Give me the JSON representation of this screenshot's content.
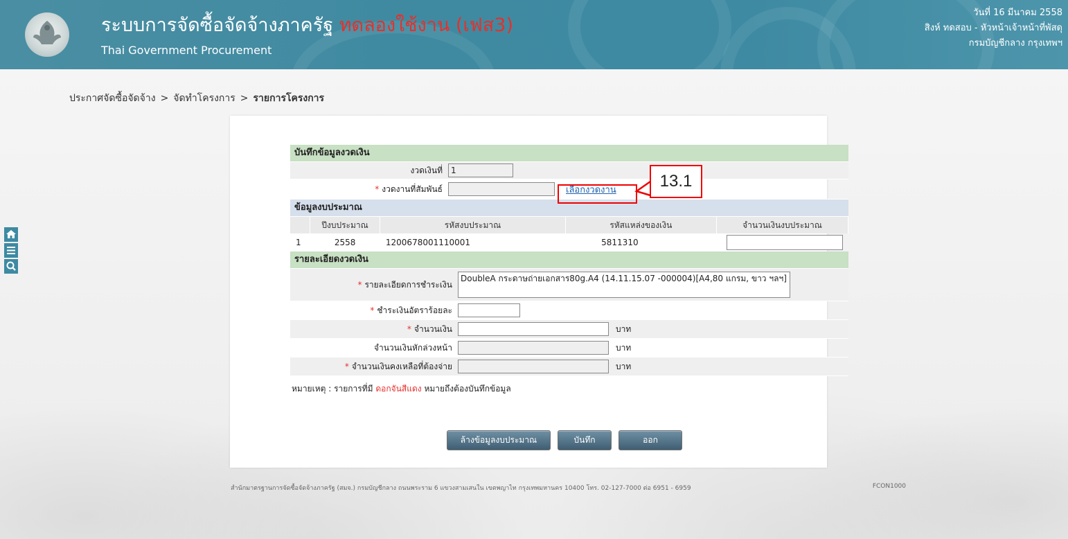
{
  "header": {
    "title": "ระบบการจัดซื้อจัดจ้างภาครัฐ",
    "trial_label": "ทดลองใช้งาน (เฟส3)",
    "subtitle": "Thai Government Procurement",
    "date": "วันที่ 16 มีนาคม 2558",
    "user": "สิงห์ ทดสอบ - หัวหน้าเจ้าหน้าที่พัสดุ",
    "department": "กรมบัญชีกลาง กรุงเทพฯ",
    "logo_text": "กรมบัญชีกลาง"
  },
  "breadcrumb": {
    "items": [
      "ประกาศจัดซื้อจัดจ้าง",
      "จัดทำโครงการ",
      "รายการโครงการ"
    ],
    "separator": ">"
  },
  "side_tools": [
    "home-icon",
    "menu-icon",
    "search-icon"
  ],
  "form": {
    "section1_title": "บันทึกข้อมูลงวดเงิน",
    "installment_label": "งวดเงินที่",
    "installment_value": "1",
    "related_work_label": "งวดงานที่สัมพันธ์",
    "related_work_value": "",
    "select_work_link": "เลือกงวดงาน",
    "required_mark": "*",
    "section2_title": "ข้อมูลงบประมาณ",
    "budget_table": {
      "headers": [
        "",
        "ปีงบประมาณ",
        "รหัสงบประมาณ",
        "รหัสแหล่งของเงิน",
        "จำนวนเงินงบประมาณ"
      ],
      "rows": [
        {
          "no": "1",
          "year": "2558",
          "budget_code": "1200678001110001",
          "source_code": "5811310",
          "amount": ""
        }
      ]
    },
    "section3_title": "รายละเอียดงวดเงิน",
    "payment_detail_label": "รายละเอียดการชำระเงิน",
    "payment_detail_value": "DoubleA กระดาษถ่ายเอกสาร80g.A4 (14.11.15.07 -000004)[A4,80 แกรม, ขาว ฯลฯ]",
    "percent_label": "ชำระเงินอัตราร้อยละ",
    "percent_value": "",
    "amount_label": "จำนวนเงิน",
    "amount_value": "",
    "advance_label": "จำนวนเงินหักล่วงหน้า",
    "advance_value": "",
    "remaining_label": "จำนวนเงินคงเหลือที่ต้องจ่าย",
    "remaining_value": "",
    "unit_baht": "บาท",
    "note_prefix": "หมายเหตุ : รายการที่มี",
    "note_red": "ดอกจันสีแดง",
    "note_suffix": "หมายถึงต้องบันทึกข้อมูล"
  },
  "buttons": {
    "clear_budget": "ล้างข้อมูลงบประมาณ",
    "save": "บันทึก",
    "exit": "ออก"
  },
  "footer": {
    "text": "สำนักมาตรฐานการจัดซื้อจัดจ้างภาครัฐ (สมจ.) กรมบัญชีกลาง ถนนพระราม 6 แขวงสามเสนใน เขตพญาไท กรุงเทพมหานคร 10400 โทร. 02-127-7000 ต่อ 6951 - 6959",
    "code": "FCON1000"
  },
  "callout": {
    "label": "13.1"
  },
  "colors": {
    "header": "#3f8aa1",
    "accent_red": "#e5312c",
    "section_green": "#c8e0c3",
    "section_blue": "#d6e0ec"
  }
}
